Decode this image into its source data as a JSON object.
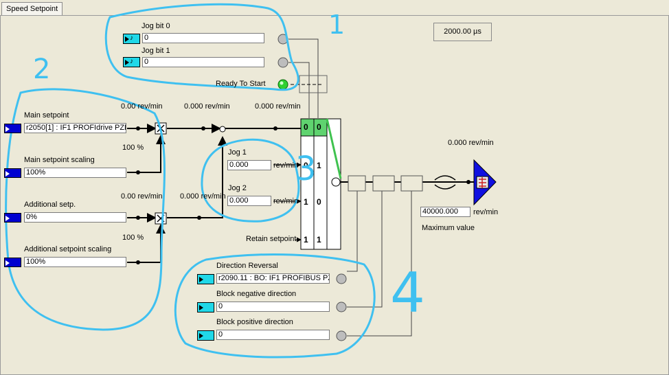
{
  "tab": {
    "label": "Speed Setpoint"
  },
  "sample_time": "2000.00 µs",
  "jog_bit0": {
    "label": "Jog bit 0",
    "value": "0"
  },
  "jog_bit1": {
    "label": "Jog bit 1",
    "value": "0"
  },
  "ready_to_start": {
    "label": "Ready To Start"
  },
  "main_setpoint": {
    "label": "Main setpoint",
    "value": "r2050[1] : IF1 PROFIdrive PZD",
    "display": "0.00 rev/min"
  },
  "main_scaling": {
    "label": "Main setpoint scaling",
    "value": "100%",
    "display": "100 %"
  },
  "additional_setp": {
    "label": "Additional setp.",
    "value": "0%",
    "display": "0.00 rev/min"
  },
  "additional_scaling": {
    "label": "Additional setpoint scaling",
    "value": "100%",
    "display": "100 %"
  },
  "after_mult": {
    "display": "0.000 rev/min"
  },
  "after_sum": {
    "display": "0.000 rev/min"
  },
  "after_add": {
    "display": "0.000 rev/min"
  },
  "jog1": {
    "label": "Jog 1",
    "value": "0.000",
    "unit": "rev/min"
  },
  "jog2": {
    "label": "Jog 2",
    "value": "0.000",
    "unit": "rev/min"
  },
  "retain_setpoint": {
    "label": "Retain setpoint"
  },
  "switch_header": [
    "0",
    "0"
  ],
  "switch_rows": [
    [
      "0",
      "1"
    ],
    [
      "1",
      "0"
    ],
    [
      "1",
      "1"
    ]
  ],
  "output": {
    "display": "0.000 rev/min"
  },
  "maximum": {
    "value": "40000.000",
    "unit": "rev/min",
    "label": "Maximum value"
  },
  "direction_reversal": {
    "label": "Direction Reversal",
    "value": "r2090.11 : BO: IF1 PROFIBUS PZ"
  },
  "block_negative": {
    "label": "Block negative direction",
    "value": "0"
  },
  "block_positive": {
    "label": "Block positive direction",
    "value": "0"
  },
  "annotations": [
    "1",
    "2",
    "3",
    "4"
  ]
}
